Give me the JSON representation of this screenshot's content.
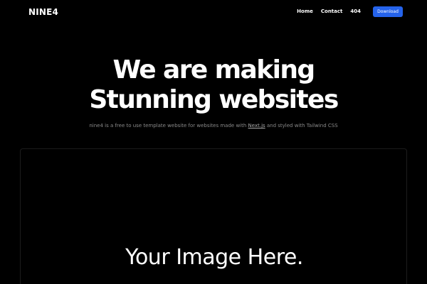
{
  "header": {
    "brand": "NINE4",
    "nav": [
      {
        "label": "Home"
      },
      {
        "label": "Contact"
      },
      {
        "label": "404"
      }
    ],
    "download_label": "Download"
  },
  "hero": {
    "title_line1": "We are making",
    "title_line2": "Stunning websites",
    "subtitle_before": "nine4 is a free to use template website for websites made with ",
    "subtitle_link": "Next.js",
    "subtitle_after": " and styled with Tailwind CSS"
  },
  "preview": {
    "caption": "Your Image Here."
  },
  "colors": {
    "background": "#000000",
    "accent": "#2563eb",
    "text": "#ffffff",
    "muted": "#8a8a8a"
  }
}
